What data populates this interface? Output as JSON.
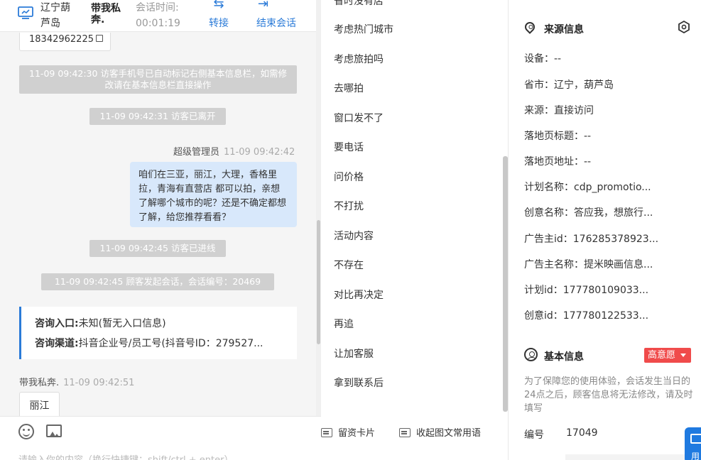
{
  "header": {
    "location": "辽宁葫芦岛",
    "visitor_name": "带我私奔.",
    "session_time_label": "会话时间:",
    "session_time_value": "00:01:19",
    "transfer_label": "转接",
    "end_label": "结束会话",
    "accent": "#2b7bd8"
  },
  "chat": {
    "phone": "18342962225",
    "messages": {
      "sys1": "11-09 09:42:30 访客手机号已自动标记右侧基本信息栏，如需修改请在基本信息栏直接操作",
      "sys2": "11-09 09:42:31 访客已离开",
      "agent_name": "超级管理员",
      "agent_time": "11-09 09:42:42",
      "agent_text": "咱们在三亚，丽江，大理，香格里拉，青海有直营店 都可以拍，亲想了解哪个城市的呢？还是不确定都想了解，给您推荐看看？",
      "sys3": "11-09 09:42:45 访客已进线",
      "sys4": "11-09 09:42:45 顾客发起会话，会话编号：20469",
      "entry_label": "咨询入口:",
      "entry_value": "未知(暂无入口信息)",
      "channel_label": "咨询渠道:",
      "channel_value": "抖音企业号/员工号(抖音号ID：279527...",
      "visitor_name": "带我私奔.",
      "visitor_time": "11-09 09:42:51",
      "visitor_text": "丽江"
    },
    "input_placeholder": "请输入你的内容（换行快捷键：shift/ctrl + enter）"
  },
  "quick_replies": {
    "items": [
      "省时没有店",
      "考虑热门城市",
      "考虑旅拍吗",
      "去哪拍",
      "窗口发不了",
      "要电话",
      "问价格",
      "不打扰",
      "活动内容",
      "不存在",
      "对比再决定",
      "再追",
      "让加客服",
      "拿到联系后"
    ],
    "card_btn": "留资卡片",
    "collapse_btn": "收起图文常用语"
  },
  "source_info": {
    "title": "来源信息",
    "rows": [
      "设备：--",
      "省市：辽宁，葫芦岛",
      "来源：直接访问",
      "落地页标题：--",
      "落地页地址：--",
      "计划名称：cdp_promotio...",
      "创意名称：答应我，想旅行...",
      "广告主id：176285378923...",
      "广告主名称：提米映画信息...",
      "计划id：177780109033...",
      "创意id：177780122533..."
    ]
  },
  "basic_info": {
    "title": "基本信息",
    "intent_badge": "高意愿",
    "badge_color": "#f04b4b",
    "note": "为了保障您的使用体验，会话发生当日的24点之后，顾客信息将无法修改，请及时填写",
    "id_label": "编号",
    "id_value": "17049",
    "float_btn": "用"
  }
}
